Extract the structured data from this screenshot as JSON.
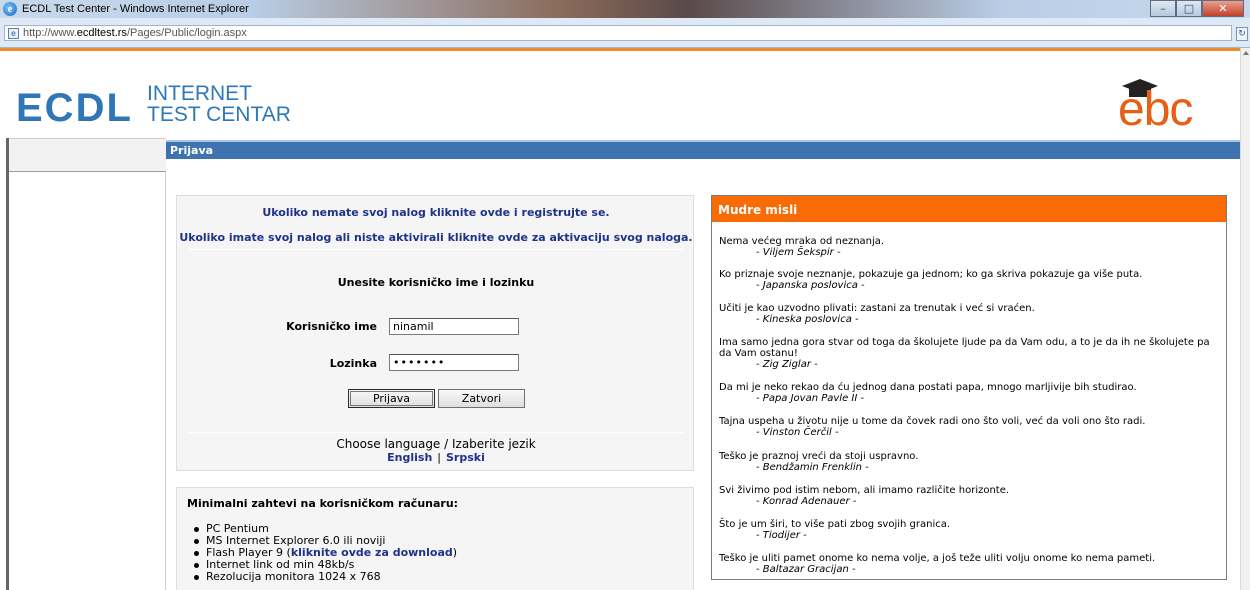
{
  "browser": {
    "window_title": "ECDL Test Center - Windows Internet Explorer",
    "url_prefix": "http://www.",
    "url_domain": "ecdltest.rs",
    "url_path": "/Pages/Public/login.aspx"
  },
  "header": {
    "logo_main": "ECDL",
    "logo_line1": "INTERNET",
    "logo_line2": "TEST CENTAR",
    "partner_logo": "ebc"
  },
  "page_header": {
    "title": "Prijava"
  },
  "login": {
    "register_link": "Ukoliko nemate svoj nalog kliknite ovde i registrujte se.",
    "activate_link": "Ukoliko imate svoj nalog ali niste aktivirali kliknite ovde za aktivaciju svog naloga.",
    "heading": "Unesite korisničko ime i lozinku",
    "username_label": "Korisničko ime",
    "username_value": "ninamil",
    "password_label": "Lozinka",
    "password_value": "•••••••",
    "login_button": "Prijava",
    "close_button": "Zatvori",
    "language_label": "Choose language / Izaberite jezik",
    "language_english": "English",
    "language_separator": "|",
    "language_serbian": "Srpski"
  },
  "requirements": {
    "title": "Minimalni zahtevi na korisničkom računaru:",
    "items": [
      "PC Pentium",
      "MS Internet Explorer 6.0 ili noviji",
      "Flash Player 9 (",
      "Internet link od min 48kb/s",
      "Rezolucija monitora 1024 x 768"
    ],
    "flash_link": "kliknite ovde za download",
    "flash_suffix": ")"
  },
  "quotes": {
    "title": "Mudre misli",
    "items": [
      {
        "text": "Nema većeg mraka od neznanja.",
        "author": "- Viljem Šekspir -"
      },
      {
        "text": "Ko priznaje svoje neznanje, pokazuje ga jednom; ko ga skriva pokazuje ga više puta.",
        "author": "- Japanska poslovica -"
      },
      {
        "text": "Učiti je kao uzvodno plivati: zastani za trenutak i već si vraćen.",
        "author": "- Kineska poslovica -"
      },
      {
        "text": "Ima samo jedna gora stvar od toga da školujete ljude pa da Vam odu, a to je da ih ne školujete pa da Vam ostanu!",
        "author": "- Zig Ziglar -"
      },
      {
        "text": "Da mi je neko rekao da ću jednog dana postati papa, mnogo marljivije bih studirao.",
        "author": "- Papa Jovan Pavle II -"
      },
      {
        "text": "Tajna uspeha u životu nije u tome da čovek radi ono što voli, već da voli ono što radi.",
        "author": "- Vinston Čerčil -"
      },
      {
        "text": "Teško je praznoj vreći da stoji uspravno.",
        "author": "- Bendžamin Frenklin -"
      },
      {
        "text": "Svi živimo pod istim nebom, ali imamo različite horizonte.",
        "author": "- Konrad Adenauer -"
      },
      {
        "text": "Što je um širi, to više pati zbog svojih granica.",
        "author": "- Tiodijer -"
      },
      {
        "text": "Teško je uliti pamet onome ko nema volje, a još teže uliti volju onome ko nema pameti.",
        "author": "- Baltazar Gracijan -"
      }
    ]
  },
  "colors": {
    "ecdl_blue": "#2f77b8",
    "header_bar": "#3f73b0",
    "quotes_orange": "#f96b06",
    "link_blue": "#1e3289",
    "ebc_orange": "#e85e14"
  }
}
